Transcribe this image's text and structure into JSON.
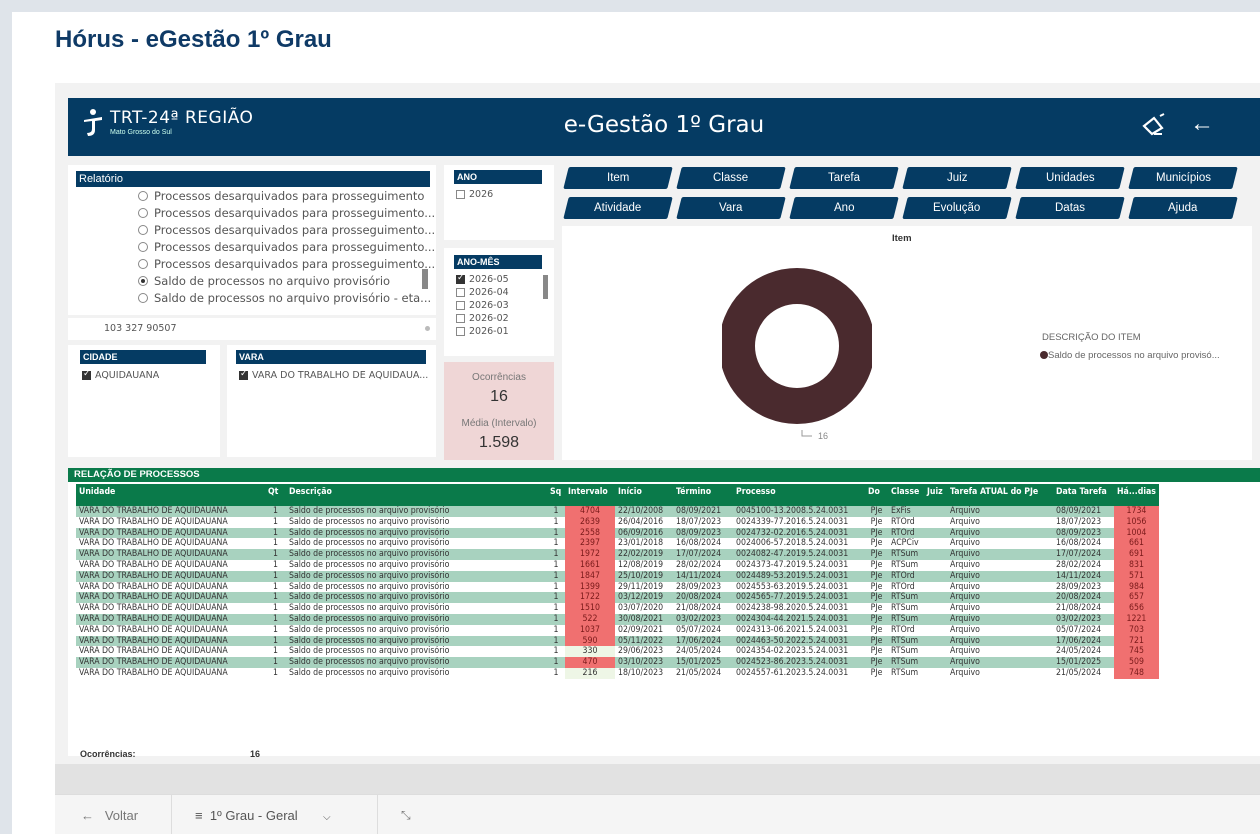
{
  "page_title": "Hórus - eGestão 1º Grau",
  "header": {
    "logo_text": "TRT-24ª REGIÃO",
    "logo_subtext": "Mato Grosso do Sul",
    "title": "e-Gestão 1º Grau"
  },
  "relatorio": {
    "label": "Relatório",
    "options": [
      {
        "label": "Processos desarquivados para prosseguimento",
        "selected": false
      },
      {
        "label": "Processos desarquivados para prosseguimento...",
        "selected": false
      },
      {
        "label": "Processos desarquivados para prosseguimento...",
        "selected": false
      },
      {
        "label": "Processos desarquivados para prosseguimento...",
        "selected": false
      },
      {
        "label": "Processos desarquivados para prosseguimento...",
        "selected": false
      },
      {
        "label": "Saldo de processos no arquivo provisório",
        "selected": true
      },
      {
        "label": "Saldo de processos no arquivo provisório - eta...",
        "selected": false
      }
    ],
    "codes": "103   327   90507"
  },
  "ano": {
    "label": "ANO",
    "options": [
      {
        "label": "2026",
        "checked": false
      }
    ]
  },
  "ano_mes": {
    "label": "ANO-MÊS",
    "options": [
      {
        "label": "2026-05",
        "checked": true
      },
      {
        "label": "2026-04",
        "checked": false
      },
      {
        "label": "2026-03",
        "checked": false
      },
      {
        "label": "2026-02",
        "checked": false
      },
      {
        "label": "2026-01",
        "checked": false
      }
    ]
  },
  "cidade": {
    "label": "CIDADE",
    "value": "AQUIDAUANA"
  },
  "vara": {
    "label": "VARA",
    "value": "VARA DO TRABALHO DE AQUIDAUA..."
  },
  "kpi": {
    "ocorrencias_label": "Ocorrências",
    "ocorrencias_value": "16",
    "media_label": "Média (Intervalo)",
    "media_value": "1.598"
  },
  "nav_buttons": {
    "row1": [
      "Item",
      "Classe",
      "Tarefa",
      "Juiz",
      "Unidades",
      "Municípios"
    ],
    "row2": [
      "Atividade",
      "Vara",
      "Ano",
      "Evolução",
      "Datas",
      "Ajuda"
    ]
  },
  "donut": {
    "title": "Item",
    "legend_title": "DESCRIÇÃO DO ITEM",
    "legend_item": "Saldo de processos no arquivo provisó...",
    "value_label": "16",
    "color": "#4a2a2e"
  },
  "table": {
    "title": "RELAÇÃO DE PROCESSOS",
    "columns": [
      "Unidade",
      "Qt",
      "Descrição",
      "Sq",
      "Intervalo",
      "Início",
      "Término",
      "Processo",
      "Do",
      "Classe",
      "Juiz",
      "Tarefa ATUAL do PJe",
      "Data Tarefa",
      "Há...dias"
    ],
    "rows": [
      [
        "VARA DO TRABALHO DE AQUIDAUANA",
        "1",
        "Saldo de processos no arquivo provisório",
        "1",
        "4704",
        "22/10/2008",
        "08/09/2021",
        "0045100-13.2008.5.24.0031",
        "PJe",
        "ExFis",
        "",
        "Arquivo",
        "08/09/2021",
        "1734"
      ],
      [
        "VARA DO TRABALHO DE AQUIDAUANA",
        "1",
        "Saldo de processos no arquivo provisório",
        "1",
        "2639",
        "26/04/2016",
        "18/07/2023",
        "0024339-77.2016.5.24.0031",
        "PJe",
        "RTOrd",
        "",
        "Arquivo",
        "18/07/2023",
        "1056"
      ],
      [
        "VARA DO TRABALHO DE AQUIDAUANA",
        "1",
        "Saldo de processos no arquivo provisório",
        "1",
        "2558",
        "06/09/2016",
        "08/09/2023",
        "0024732-02.2016.5.24.0031",
        "PJe",
        "RTOrd",
        "",
        "Arquivo",
        "08/09/2023",
        "1004"
      ],
      [
        "VARA DO TRABALHO DE AQUIDAUANA",
        "1",
        "Saldo de processos no arquivo provisório",
        "1",
        "2397",
        "23/01/2018",
        "16/08/2024",
        "0024006-57.2018.5.24.0031",
        "PJe",
        "ACPCiv",
        "",
        "Arquivo",
        "16/08/2024",
        "661"
      ],
      [
        "VARA DO TRABALHO DE AQUIDAUANA",
        "1",
        "Saldo de processos no arquivo provisório",
        "1",
        "1972",
        "22/02/2019",
        "17/07/2024",
        "0024082-47.2019.5.24.0031",
        "PJe",
        "RTSum",
        "",
        "Arquivo",
        "17/07/2024",
        "691"
      ],
      [
        "VARA DO TRABALHO DE AQUIDAUANA",
        "1",
        "Saldo de processos no arquivo provisório",
        "1",
        "1661",
        "12/08/2019",
        "28/02/2024",
        "0024373-47.2019.5.24.0031",
        "PJe",
        "RTSum",
        "",
        "Arquivo",
        "28/02/2024",
        "831"
      ],
      [
        "VARA DO TRABALHO DE AQUIDAUANA",
        "1",
        "Saldo de processos no arquivo provisório",
        "1",
        "1847",
        "25/10/2019",
        "14/11/2024",
        "0024489-53.2019.5.24.0031",
        "PJe",
        "RTOrd",
        "",
        "Arquivo",
        "14/11/2024",
        "571"
      ],
      [
        "VARA DO TRABALHO DE AQUIDAUANA",
        "1",
        "Saldo de processos no arquivo provisório",
        "1",
        "1399",
        "29/11/2019",
        "28/09/2023",
        "0024553-63.2019.5.24.0031",
        "PJe",
        "RTOrd",
        "",
        "Arquivo",
        "28/09/2023",
        "984"
      ],
      [
        "VARA DO TRABALHO DE AQUIDAUANA",
        "1",
        "Saldo de processos no arquivo provisório",
        "1",
        "1722",
        "03/12/2019",
        "20/08/2024",
        "0024565-77.2019.5.24.0031",
        "PJe",
        "RTSum",
        "",
        "Arquivo",
        "20/08/2024",
        "657"
      ],
      [
        "VARA DO TRABALHO DE AQUIDAUANA",
        "1",
        "Saldo de processos no arquivo provisório",
        "1",
        "1510",
        "03/07/2020",
        "21/08/2024",
        "0024238-98.2020.5.24.0031",
        "PJe",
        "RTSum",
        "",
        "Arquivo",
        "21/08/2024",
        "656"
      ],
      [
        "VARA DO TRABALHO DE AQUIDAUANA",
        "1",
        "Saldo de processos no arquivo provisório",
        "1",
        "522",
        "30/08/2021",
        "03/02/2023",
        "0024304-44.2021.5.24.0031",
        "PJe",
        "RTSum",
        "",
        "Arquivo",
        "03/02/2023",
        "1221"
      ],
      [
        "VARA DO TRABALHO DE AQUIDAUANA",
        "1",
        "Saldo de processos no arquivo provisório",
        "1",
        "1037",
        "02/09/2021",
        "05/07/2024",
        "0024313-06.2021.5.24.0031",
        "PJe",
        "RTOrd",
        "",
        "Arquivo",
        "05/07/2024",
        "703"
      ],
      [
        "VARA DO TRABALHO DE AQUIDAUANA",
        "1",
        "Saldo de processos no arquivo provisório",
        "1",
        "590",
        "05/11/2022",
        "17/06/2024",
        "0024463-50.2022.5.24.0031",
        "PJe",
        "RTSum",
        "",
        "Arquivo",
        "17/06/2024",
        "721"
      ],
      [
        "VARA DO TRABALHO DE AQUIDAUANA",
        "1",
        "Saldo de processos no arquivo provisório",
        "1",
        "330",
        "29/06/2023",
        "24/05/2024",
        "0024354-02.2023.5.24.0031",
        "PJe",
        "RTSum",
        "",
        "Arquivo",
        "24/05/2024",
        "745"
      ],
      [
        "VARA DO TRABALHO DE AQUIDAUANA",
        "1",
        "Saldo de processos no arquivo provisório",
        "1",
        "470",
        "03/10/2023",
        "15/01/2025",
        "0024523-86.2023.5.24.0031",
        "PJe",
        "RTSum",
        "",
        "Arquivo",
        "15/01/2025",
        "509"
      ],
      [
        "VARA DO TRABALHO DE AQUIDAUANA",
        "1",
        "Saldo de processos no arquivo provisório",
        "1",
        "216",
        "18/10/2023",
        "21/05/2024",
        "0024557-61.2023.5.24.0031",
        "PJe",
        "RTSum",
        "",
        "Arquivo",
        "21/05/2024",
        "748"
      ]
    ],
    "footer_label": "Ocorrências:",
    "footer_value": "16"
  },
  "bottom_nav": {
    "back": "Voltar",
    "page": "1º Grau - Geral"
  }
}
